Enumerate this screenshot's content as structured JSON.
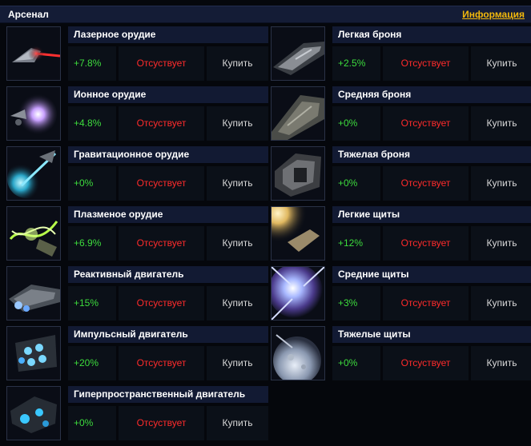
{
  "header": {
    "title": "Арсенал",
    "info_link": "Информация"
  },
  "left_column": [
    {
      "name": "Лазерное орудие",
      "bonus": "+7.8%",
      "status": "Отсуствует",
      "buy": "Купить",
      "icon": "laser-cannon-icon"
    },
    {
      "name": "Ионное орудие",
      "bonus": "+4.8%",
      "status": "Отсуствует",
      "buy": "Купить",
      "icon": "ion-cannon-icon"
    },
    {
      "name": "Гравитационное орудие",
      "bonus": "+0%",
      "status": "Отсуствует",
      "buy": "Купить",
      "icon": "gravity-cannon-icon"
    },
    {
      "name": "Плазменое орудие",
      "bonus": "+6.9%",
      "status": "Отсуствует",
      "buy": "Купить",
      "icon": "plasma-cannon-icon"
    },
    {
      "name": "Реактивный двигатель",
      "bonus": "+15%",
      "status": "Отсуствует",
      "buy": "Купить",
      "icon": "jet-engine-icon"
    },
    {
      "name": "Импульсный двигатель",
      "bonus": "+20%",
      "status": "Отсуствует",
      "buy": "Купить",
      "icon": "impulse-engine-icon"
    },
    {
      "name": "Гиперпространственный двигатель",
      "bonus": "+0%",
      "status": "Отсуствует",
      "buy": "Купить",
      "icon": "hyperspace-engine-icon"
    }
  ],
  "right_column": [
    {
      "name": "Легкая броня",
      "bonus": "+2.5%",
      "status": "Отсуствует",
      "buy": "Купить",
      "icon": "light-armor-icon"
    },
    {
      "name": "Средняя броня",
      "bonus": "+0%",
      "status": "Отсуствует",
      "buy": "Купить",
      "icon": "medium-armor-icon"
    },
    {
      "name": "Тяжелая броня",
      "bonus": "+0%",
      "status": "Отсуствует",
      "buy": "Купить",
      "icon": "heavy-armor-icon"
    },
    {
      "name": "Легкие щиты",
      "bonus": "+12%",
      "status": "Отсуствует",
      "buy": "Купить",
      "icon": "light-shield-icon"
    },
    {
      "name": "Средние щиты",
      "bonus": "+3%",
      "status": "Отсуствует",
      "buy": "Купить",
      "icon": "medium-shield-icon"
    },
    {
      "name": "Тяжелые щиты",
      "bonus": "+0%",
      "status": "Отсуствует",
      "buy": "Купить",
      "icon": "heavy-shield-icon"
    }
  ],
  "colors": {
    "bonus": "#3ddc3d",
    "status": "#ff2b2b",
    "info_link": "#f2b80c",
    "name_bar": "#121a33",
    "cell_bg": "#0b1018"
  }
}
